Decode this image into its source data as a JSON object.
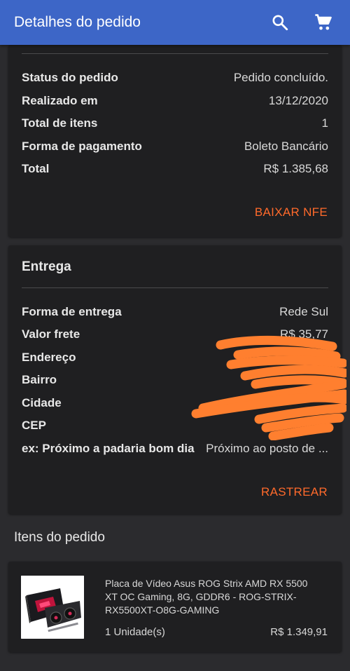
{
  "appbar": {
    "title": "Detalhes do pedido",
    "icons": [
      "search-icon",
      "cart-icon"
    ],
    "color": "#3d66c7"
  },
  "order": {
    "rows": [
      {
        "label": "Status do pedido",
        "value": "Pedido concluído."
      },
      {
        "label": "Realizado em",
        "value": "13/12/2020"
      },
      {
        "label": "Total de itens",
        "value": "1"
      },
      {
        "label": "Forma de pagamento",
        "value": "Boleto Bancário"
      },
      {
        "label": "Total",
        "value": "R$ 1.385,68"
      }
    ],
    "action_label": "BAIXAR NFE"
  },
  "delivery": {
    "title": "Entrega",
    "rows": [
      {
        "label": "Forma de entrega",
        "value": "Rede Sul"
      },
      {
        "label": "Valor frete",
        "value": "R$ 35,77"
      },
      {
        "label": "Endereço",
        "value": ""
      },
      {
        "label": "Bairro",
        "value": ""
      },
      {
        "label": "Cidade",
        "value": ""
      },
      {
        "label": "CEP",
        "value": ""
      },
      {
        "label": "ex: Próximo a padaria bom dia",
        "value": "Próximo ao posto de ..."
      }
    ],
    "action_label": "RASTREAR"
  },
  "items": {
    "title": "Itens do pedido",
    "list": [
      {
        "name": "Placa de Vídeo Asus ROG Strix AMD RX 5500 XT OC Gaming, 8G, GDDR6 - ROG-STRIX-RX5500XT-O8G-GAMING",
        "quantity": "1 Unidade(s)",
        "price": "R$ 1.349,91",
        "icon": "graphics-card-image"
      }
    ]
  },
  "colors": {
    "accent": "#ff6a2b",
    "background": "#2b2b2e",
    "card": "#1f1f21",
    "redaction": "#ff7f2f"
  }
}
